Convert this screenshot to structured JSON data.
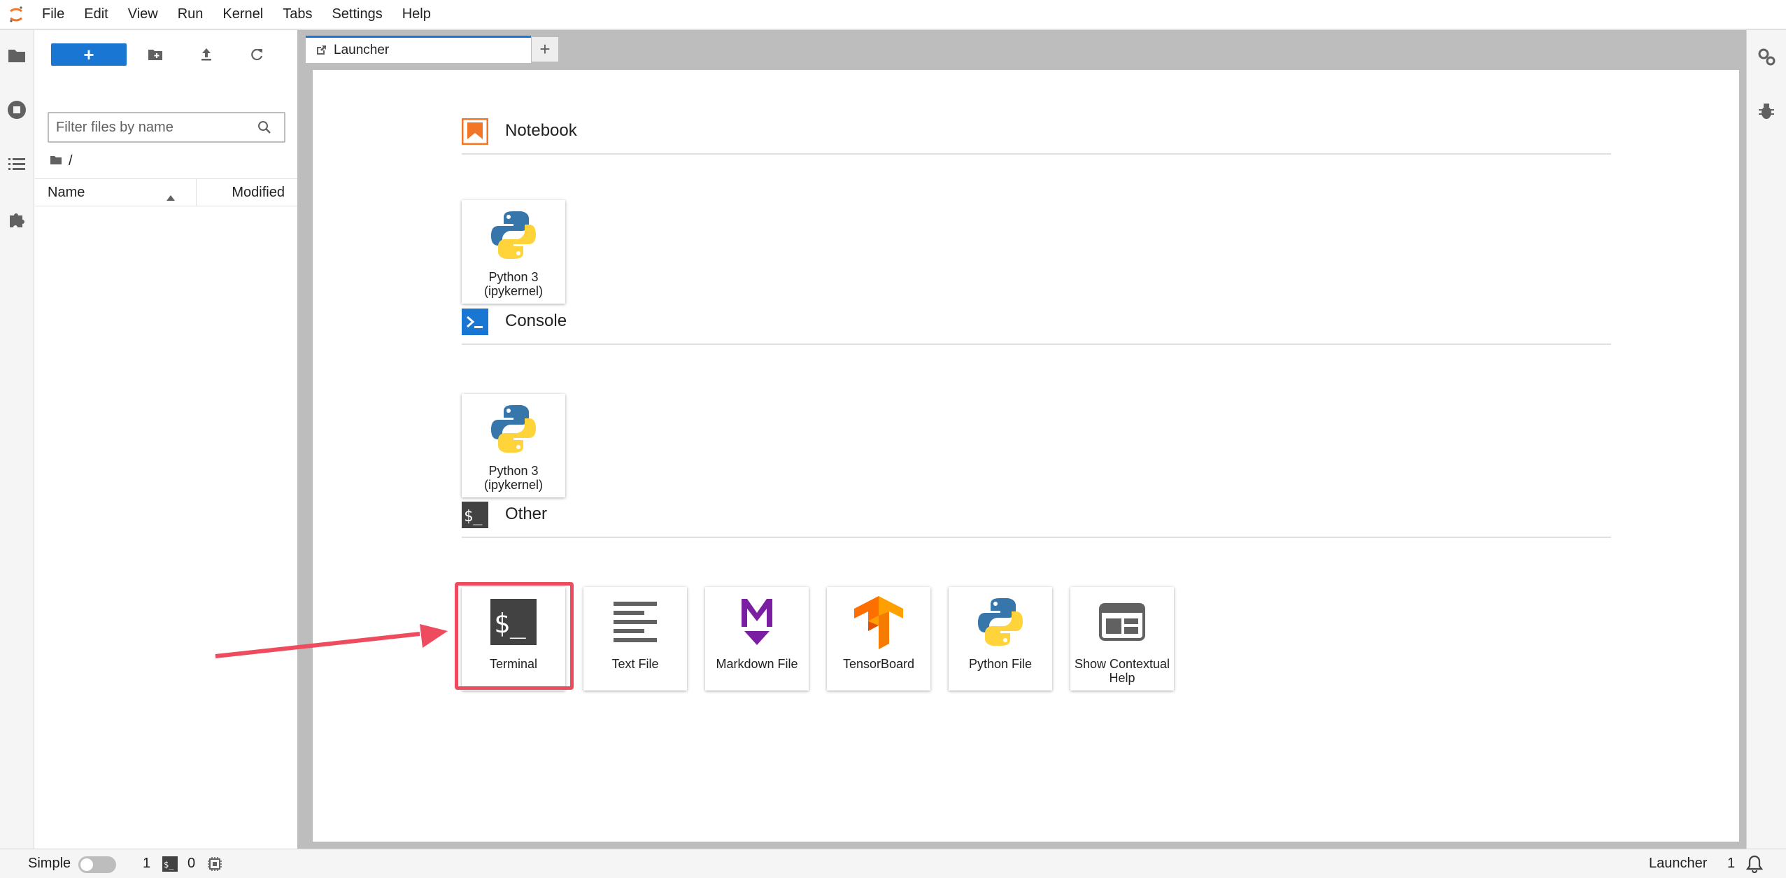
{
  "menu": [
    "File",
    "Edit",
    "View",
    "Run",
    "Kernel",
    "Tabs",
    "Settings",
    "Help"
  ],
  "file_browser": {
    "new_button_label": "+",
    "filter_placeholder": "Filter files by name",
    "breadcrumb": "/",
    "columns": {
      "name": "Name",
      "modified": "Modified"
    }
  },
  "tabs": [
    {
      "label": "Launcher",
      "active": true
    }
  ],
  "tab_add_label": "+",
  "launcher": {
    "sections": [
      {
        "title": "Notebook",
        "icon": "notebook-icon",
        "cards": [
          {
            "label": "Python 3 (ipykernel)",
            "icon": "python-icon"
          }
        ]
      },
      {
        "title": "Console",
        "icon": "console-icon",
        "cards": [
          {
            "label": "Python 3 (ipykernel)",
            "icon": "python-icon"
          }
        ]
      },
      {
        "title": "Other",
        "icon": "terminal-icon",
        "cards": [
          {
            "label": "Terminal",
            "icon": "terminal-icon",
            "highlighted": true
          },
          {
            "label": "Text File",
            "icon": "text-file-icon"
          },
          {
            "label": "Markdown File",
            "icon": "markdown-icon"
          },
          {
            "label": "TensorBoard",
            "icon": "tensorboard-icon"
          },
          {
            "label": "Python File",
            "icon": "python-icon"
          },
          {
            "label": "Show Contextual Help",
            "icon": "contextual-help-icon"
          }
        ]
      }
    ]
  },
  "status_bar": {
    "mode_label": "Simple",
    "mode_enabled": false,
    "terminals_count": "1",
    "kernels_count": "0",
    "right_label": "Launcher",
    "notifications_count": "1"
  },
  "colors": {
    "accent": "#1976d2",
    "highlight_box": "#ef4b5e",
    "notebook_orange": "#f37626",
    "markdown_purple": "#7b1fa2",
    "tensorboard_orange": "#f57c00"
  }
}
